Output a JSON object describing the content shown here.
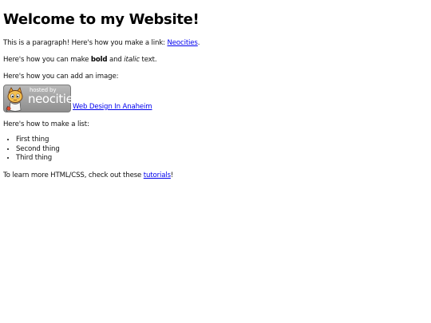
{
  "heading": "Welcome to my Website!",
  "para1": {
    "prefix": "This is a paragraph! Here's how you make a link: ",
    "link": "Neocities",
    "suffix": "."
  },
  "para2": {
    "prefix": "Here's how you can make ",
    "bold": "bold",
    "middle": " and ",
    "italic": "italic",
    "suffix": " text."
  },
  "para3": "Here's how you can add an image:",
  "image": {
    "alt": "Hosted by Neocities",
    "badge_small": "hosted by",
    "badge_big": "neocities",
    "link": "Web Design In Anaheim"
  },
  "para5": "Here's how to make a list:",
  "list": [
    "First thing",
    "Second thing",
    "Third thing"
  ],
  "para6": {
    "prefix": "To learn more HTML/CSS, check out these ",
    "link": "tutorials",
    "suffix": "!"
  }
}
